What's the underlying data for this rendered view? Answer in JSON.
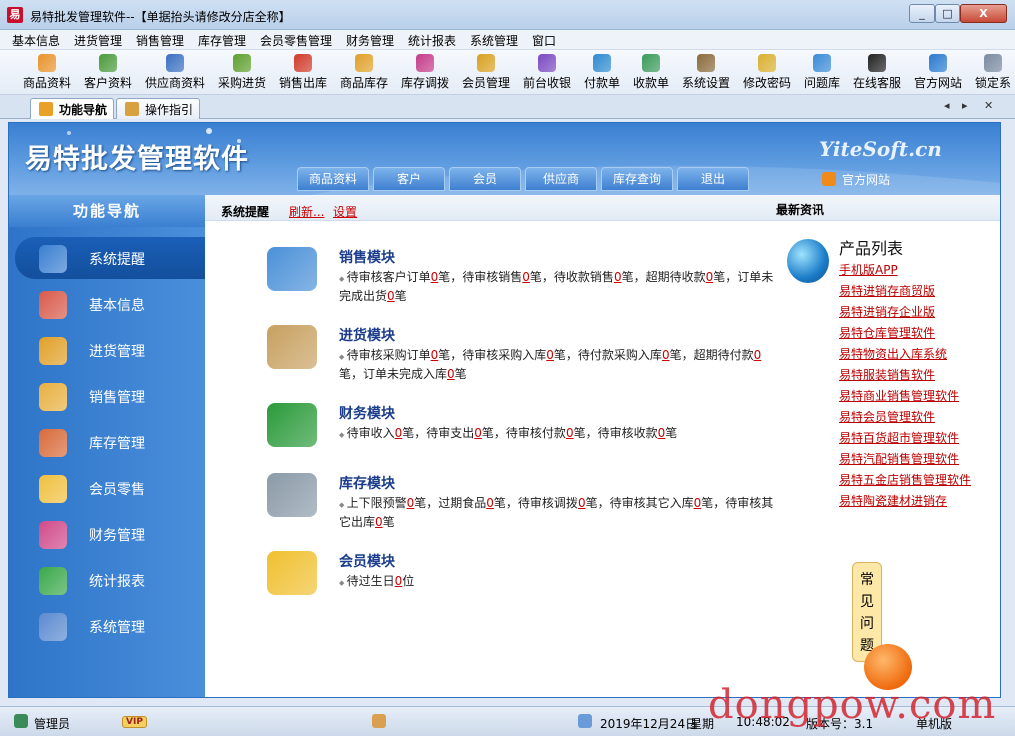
{
  "window": {
    "title": "易特批发管理软件--【单据抬头请修改分店全称】",
    "logo_text": "易",
    "controls": [
      "_",
      "□",
      "X"
    ]
  },
  "menu": [
    "基本信息",
    "进货管理",
    "销售管理",
    "库存管理",
    "会员零售管理",
    "财务管理",
    "统计报表",
    "系统管理",
    "窗口"
  ],
  "toolbar": [
    {
      "label": "商品资料",
      "icon": "box-icon",
      "color": "#e8932a"
    },
    {
      "label": "客户资料",
      "icon": "people-icon",
      "color": "#4a9a3c"
    },
    {
      "label": "供应商资料",
      "icon": "supplier-icon",
      "color": "#3a6fc2"
    },
    {
      "label": "采购进货",
      "icon": "truck-icon",
      "color": "#5e9e2e"
    },
    {
      "label": "销售出库",
      "icon": "cart-icon",
      "color": "#d03a2a"
    },
    {
      "label": "商品库存",
      "icon": "stock-icon",
      "color": "#e0a028"
    },
    {
      "label": "库存调拨",
      "icon": "transfer-icon",
      "color": "#c43c8a"
    },
    {
      "label": "会员管理",
      "icon": "member-icon",
      "color": "#d8a020"
    },
    {
      "label": "前台收银",
      "icon": "cashier-icon",
      "color": "#7a4ac0"
    },
    {
      "label": "付款单",
      "icon": "payment-icon",
      "color": "#2e8ad0"
    },
    {
      "label": "收款单",
      "icon": "receipt-icon",
      "color": "#3a9a5a"
    },
    {
      "label": "系统设置",
      "icon": "settings-icon",
      "color": "#8a6a3a"
    },
    {
      "label": "修改密码",
      "icon": "key-icon",
      "color": "#d8b030"
    },
    {
      "label": "问题库",
      "icon": "help-icon",
      "color": "#3a8ad8"
    },
    {
      "label": "在线客服",
      "icon": "chat-icon",
      "color": "#222222"
    },
    {
      "label": "官方网站",
      "icon": "ie-icon",
      "color": "#2a7ad0"
    },
    {
      "label": "锁定系",
      "icon": "lock-icon",
      "color": "#7a8aa0"
    }
  ],
  "tabs": [
    {
      "label": "功能导航",
      "active": true
    },
    {
      "label": "操作指引",
      "active": false
    }
  ],
  "tab_nav": [
    "◂",
    "▸",
    "✕"
  ],
  "banner": {
    "title": "易特批发管理软件",
    "brand": "YiteSoft.cn",
    "tabs": [
      "商品资料",
      "客户",
      "会员",
      "供应商",
      "库存查询",
      "退出"
    ],
    "official_site": "官方网站"
  },
  "nav": {
    "header": "功能导航",
    "items": [
      {
        "label": "系统提醒",
        "icon": "info-icon",
        "color": "#3a7fd1",
        "active": true
      },
      {
        "label": "基本信息",
        "icon": "basic-info-icon",
        "color": "#d85a4a"
      },
      {
        "label": "进货管理",
        "icon": "purchase-icon",
        "color": "#e0a028"
      },
      {
        "label": "销售管理",
        "icon": "sales-icon",
        "color": "#e8b040"
      },
      {
        "label": "库存管理",
        "icon": "warehouse-icon",
        "color": "#d86a3a"
      },
      {
        "label": "会员零售",
        "icon": "member-retail-icon",
        "color": "#f0c040"
      },
      {
        "label": "财务管理",
        "icon": "finance-icon",
        "color": "#d04a8a"
      },
      {
        "label": "统计报表",
        "icon": "chart-icon",
        "color": "#3aa84a"
      },
      {
        "label": "系统管理",
        "icon": "tools-icon",
        "color": "#5a8ad0"
      }
    ]
  },
  "content": {
    "system_reminder": "系统提醒",
    "refresh": "刷新...",
    "settings": "设置",
    "news": "最新资讯",
    "modules": [
      {
        "title": "销售模块",
        "icon": "sales-module-icon",
        "color": "#4a90d8",
        "desc": [
          [
            "待审核客户订单",
            "0",
            "笔，待审核销售",
            "0",
            "笔，待收款销售",
            "0",
            "笔，超期待收款",
            "0",
            "笔，订单未完成出货",
            "0",
            "笔"
          ]
        ]
      },
      {
        "title": "进货模块",
        "icon": "purchase-module-icon",
        "color": "#c8a060",
        "desc": [
          [
            "待审核采购订单",
            "0",
            "笔，待审核采购入库",
            "0",
            "笔，待付款采购入库",
            "0",
            "笔，超期待付款",
            "0",
            "笔，订单未完成入库",
            "0",
            "笔"
          ]
        ]
      },
      {
        "title": "财务模块",
        "icon": "finance-module-icon",
        "color": "#2a9a3a",
        "desc": [
          [
            "待审收入",
            "0",
            "笔，待审支出",
            "0",
            "笔，待审核付款",
            "0",
            "笔，待审核收款",
            "0",
            "笔"
          ]
        ]
      },
      {
        "title": "库存模块",
        "icon": "stock-module-icon",
        "color": "#8a9aa8",
        "desc": [
          [
            "上下限预警",
            "0",
            "笔，过期食品",
            "0",
            "笔，待审核调拨",
            "0",
            "笔，待审核其它入库",
            "0",
            "笔，待审核其它出库",
            "0",
            "笔"
          ]
        ]
      },
      {
        "title": "会员模块",
        "icon": "member-module-icon",
        "color": "#f0c030",
        "desc": [
          [
            "待过生日",
            "0",
            "位"
          ]
        ]
      }
    ],
    "product_list": {
      "title": "产品列表",
      "items": [
        "手机版APP",
        "易特进销存商贸版",
        "易特进销存企业版",
        "易特仓库管理软件",
        "易特物资出入库系统",
        "易特服装销售软件",
        "易特商业销售管理软件",
        "易特会员管理软件",
        "易特百货超市管理软件",
        "易特汽配销售管理软件",
        "易特五金店销售管理软件",
        "易特陶瓷建材进销存"
      ]
    },
    "faq": [
      "常",
      "见",
      "问",
      "题"
    ]
  },
  "statusbar": {
    "user": "管理员",
    "vip": "VIP",
    "date": "2019年12月24日",
    "weekday": "星期",
    "time": "10:48:02",
    "version": "版本号：3.1",
    "edition": "单机版"
  },
  "watermark": "dongpow.com"
}
